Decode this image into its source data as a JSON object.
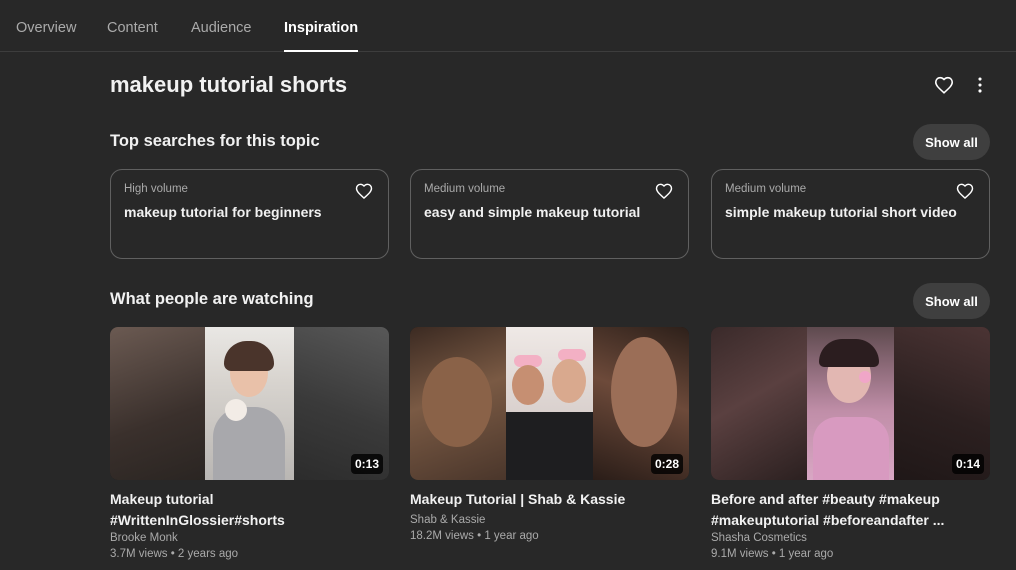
{
  "tabs": [
    {
      "label": "Overview",
      "active": false
    },
    {
      "label": "Content",
      "active": false
    },
    {
      "label": "Audience",
      "active": false
    },
    {
      "label": "Inspiration",
      "active": true
    }
  ],
  "topic": {
    "title": "makeup tutorial shorts",
    "favorite_icon": "heart-outline-icon",
    "more_icon": "more-vert-icon"
  },
  "top_searches": {
    "title": "Top searches for this topic",
    "show_all_label": "Show all",
    "items": [
      {
        "volume": "High volume",
        "term": "makeup tutorial for beginners"
      },
      {
        "volume": "Medium volume",
        "term": "easy and simple makeup tutorial"
      },
      {
        "volume": "Medium volume",
        "term": "simple makeup tutorial short video"
      }
    ]
  },
  "watching": {
    "title": "What people are watching",
    "show_all_label": "Show all",
    "videos": [
      {
        "title_line1": "Makeup tutorial",
        "title_line2": "#WrittenInGlossier#shorts",
        "channel": "Brooke Monk",
        "meta": "3.7M views • 2 years ago",
        "duration": "0:13"
      },
      {
        "title_line1": "Makeup Tutorial | Shab & Kassie",
        "title_line2": "",
        "channel": "Shab & Kassie",
        "meta": "18.2M views • 1 year ago",
        "duration": "0:28"
      },
      {
        "title_line1": "Before and after #beauty #makeup",
        "title_line2": "#makeuptutorial #beforeandafter ...",
        "channel": "Shasha Cosmetics",
        "meta": "9.1M views • 1 year ago",
        "duration": "0:14"
      }
    ]
  },
  "colors": {
    "background": "#282828",
    "text_primary": "#f1f1f1",
    "text_secondary": "#aaaaaa",
    "card_border": "#606060",
    "button_bg": "#3f3f3f"
  }
}
